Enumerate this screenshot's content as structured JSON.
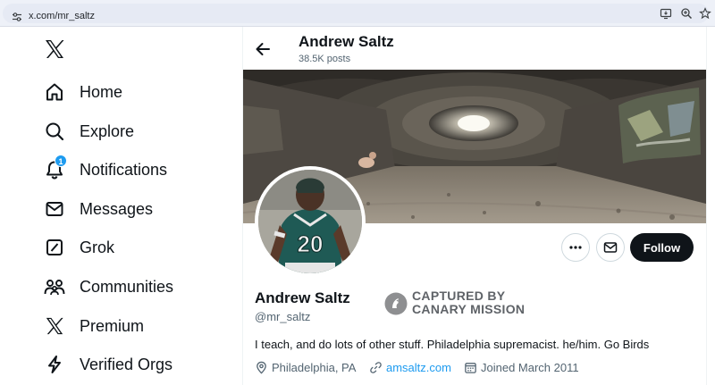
{
  "browser": {
    "url": "x.com/mr_saltz",
    "icons": [
      "site-settings-icon",
      "install-app-icon",
      "zoom-icon",
      "bookmark-star-icon"
    ]
  },
  "sidebar": {
    "logo": "x-logo-icon",
    "items": [
      {
        "label": "Home",
        "icon": "home-icon"
      },
      {
        "label": "Explore",
        "icon": "search-icon"
      },
      {
        "label": "Notifications",
        "icon": "bell-icon",
        "badge": "1"
      },
      {
        "label": "Messages",
        "icon": "envelope-icon"
      },
      {
        "label": "Grok",
        "icon": "grok-icon"
      },
      {
        "label": "Communities",
        "icon": "communities-icon"
      },
      {
        "label": "Premium",
        "icon": "x-premium-icon"
      },
      {
        "label": "Verified Orgs",
        "icon": "lightning-icon"
      }
    ]
  },
  "header": {
    "name": "Andrew Saltz",
    "post_count": "38.5K posts"
  },
  "actions": {
    "follow_label": "Follow",
    "more_icon": "more-icon",
    "message_icon": "envelope-icon"
  },
  "profile": {
    "name": "Andrew Saltz",
    "handle": "@mr_saltz",
    "bio": "I teach, and do lots of other stuff. Philadelphia supremacist. he/him. Go Birds",
    "location": "Philadelphia, PA",
    "website": "amsaltz.com",
    "joined": "Joined March 2011",
    "avatar_jersey_number": "20"
  },
  "overlay": {
    "line1": "CAPTURED BY",
    "line2": "CANARY MISSION"
  },
  "colors": {
    "accent": "#1d9bf0",
    "text_primary": "#0f1419",
    "text_secondary": "#536471",
    "follow_bg": "#0f1419"
  }
}
